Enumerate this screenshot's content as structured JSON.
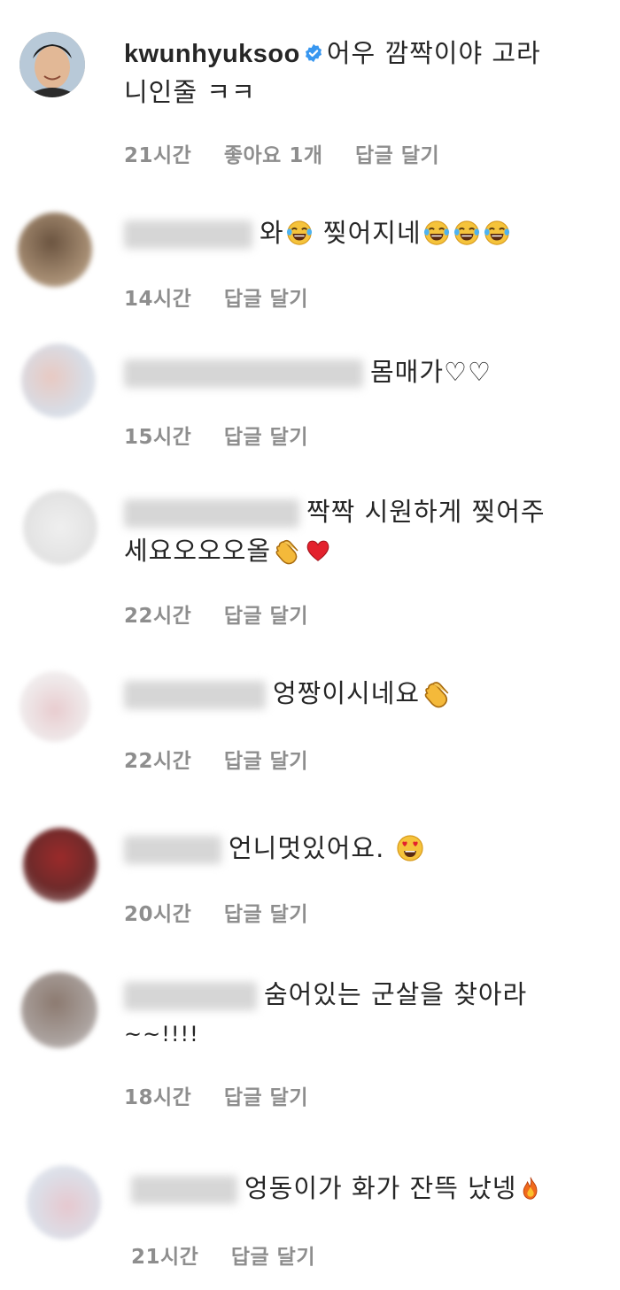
{
  "comments": [
    {
      "username": "kwunhyuksoo",
      "verified": true,
      "line1": "어우 깜짝이야 고라",
      "line2": "니인줄 ㅋㅋ",
      "time": "21시간",
      "likes": "좋아요 1개",
      "reply": "답글 달기"
    },
    {
      "text": "와",
      "text2": "찢어지네",
      "time": "14시간",
      "reply": "답글 달기"
    },
    {
      "text": "몸매가♡♡",
      "time": "15시간",
      "reply": "답글 달기"
    },
    {
      "text": "짝짝 시원하게 찢어주",
      "line2": "세요오오오올",
      "time": "22시간",
      "reply": "답글 달기"
    },
    {
      "text": "엉짱이시네요",
      "time": "22시간",
      "reply": "답글 달기"
    },
    {
      "text": "언니멋있어요.",
      "time": "20시간",
      "reply": "답글 달기"
    },
    {
      "text": "숨어있는 군살을 찾아라",
      "line2": "~~!!!!",
      "time": "18시간",
      "reply": "답글 달기"
    },
    {
      "text": "엉동이가 화가 잔뜩 났넹",
      "time": "21시간",
      "reply": "답글 달기"
    }
  ],
  "icons": {
    "verified": "verified-badge-icon",
    "tears_of_joy": "face-with-tears-of-joy-emoji",
    "clap": "clapping-hands-emoji",
    "heart": "red-heart-emoji",
    "heart_eyes": "heart-eyes-emoji",
    "fire": "fire-emoji"
  },
  "colors": {
    "verified": "#3897f0",
    "meta": "#8e8e8e",
    "text": "#262626"
  }
}
